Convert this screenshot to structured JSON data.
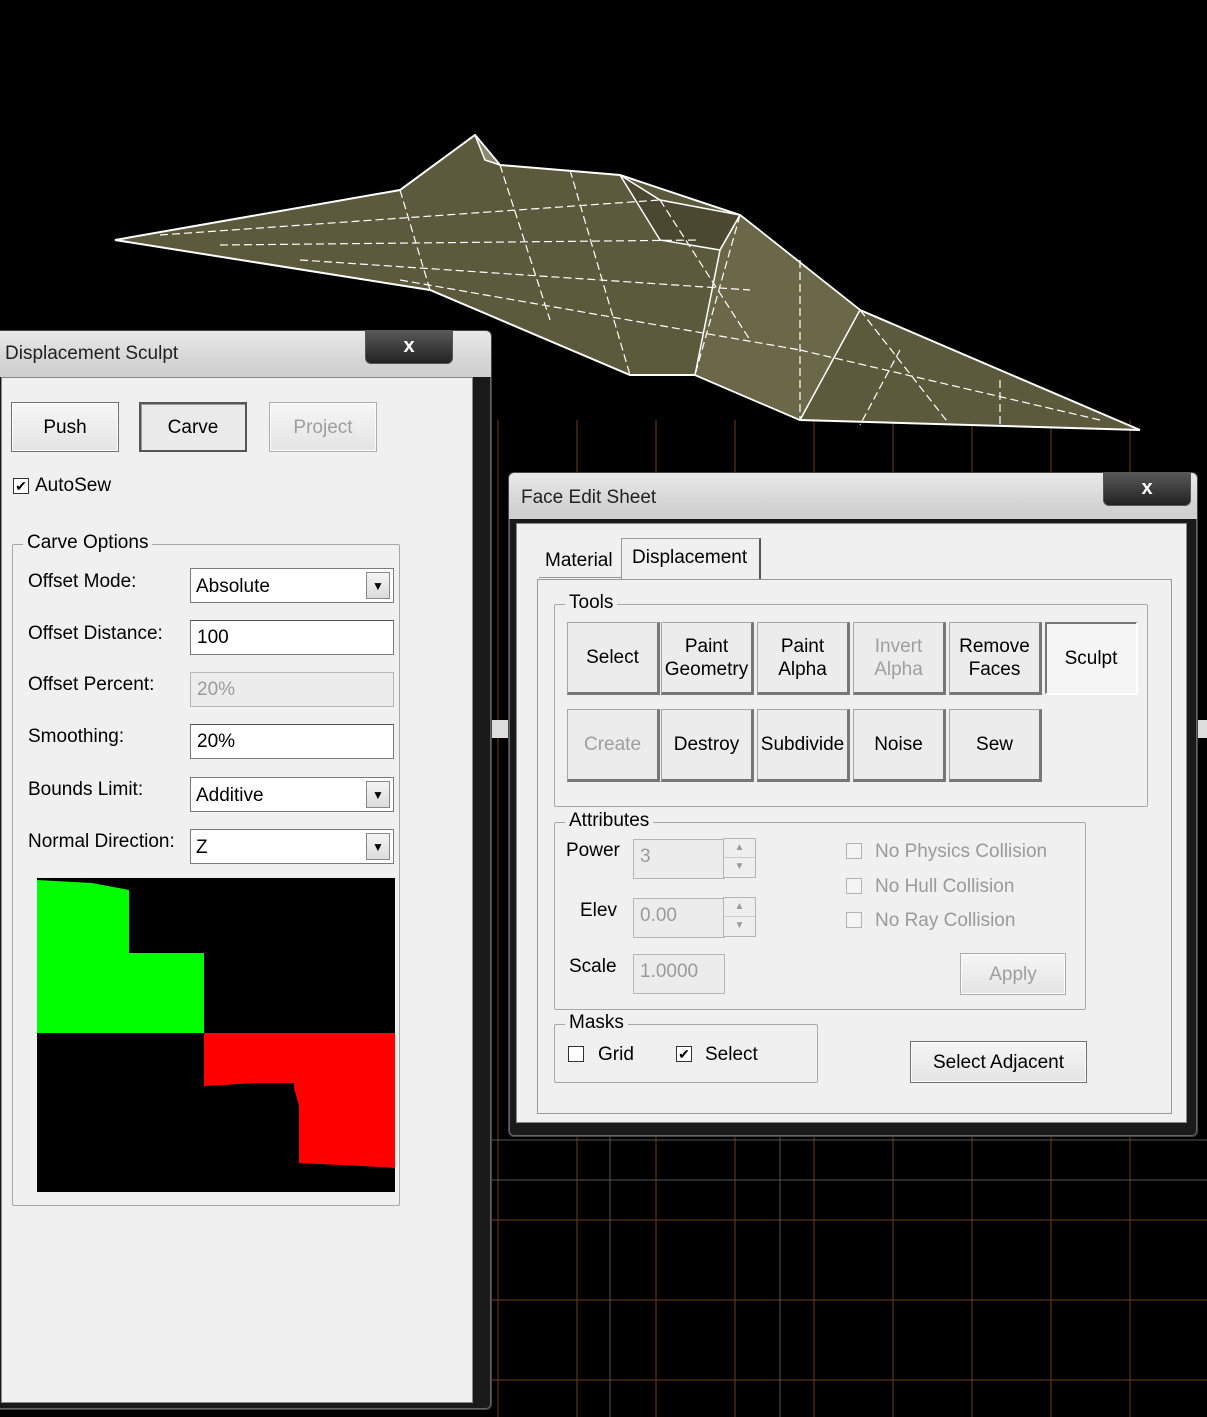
{
  "colors": {
    "green": "#00ff00",
    "red": "#ff0000",
    "terrain": "#5a5a3a",
    "grid": "#7a4a1a"
  },
  "sculpt_window": {
    "title": "Displacement Sculpt",
    "close_label": "x",
    "mode_buttons": {
      "push": "Push",
      "carve": "Carve",
      "project": "Project"
    },
    "autosew": {
      "label": "AutoSew",
      "checked": true
    },
    "carve_options": {
      "group_label": "Carve Options",
      "offset_mode_label": "Offset Mode:",
      "offset_mode_value": "Absolute",
      "offset_distance_label": "Offset Distance:",
      "offset_distance_value": "100",
      "offset_percent_label": "Offset Percent:",
      "offset_percent_value": "20%",
      "smoothing_label": "Smoothing:",
      "smoothing_value": "20%",
      "bounds_limit_label": "Bounds Limit:",
      "bounds_limit_value": "Additive",
      "normal_direction_label": "Normal Direction:",
      "normal_direction_value": "Z"
    }
  },
  "face_edit_window": {
    "title": "Face Edit Sheet",
    "close_label": "x",
    "tabs": {
      "material": "Material",
      "displacement": "Displacement"
    },
    "tools": {
      "group_label": "Tools",
      "select": "Select",
      "paint_geometry_1": "Paint",
      "paint_geometry_2": "Geometry",
      "paint_alpha_1": "Paint",
      "paint_alpha_2": "Alpha",
      "invert_alpha_1": "Invert",
      "invert_alpha_2": "Alpha",
      "remove_faces_1": "Remove",
      "remove_faces_2": "Faces",
      "sculpt": "Sculpt",
      "create": "Create",
      "destroy": "Destroy",
      "subdivide": "Subdivide",
      "noise": "Noise",
      "sew": "Sew"
    },
    "attributes": {
      "group_label": "Attributes",
      "power_label": "Power",
      "power_value": "3",
      "elev_label": "Elev",
      "elev_value": "0.00",
      "scale_label": "Scale",
      "scale_value": "1.0000",
      "no_physics": "No Physics Collision",
      "no_hull": "No Hull Collision",
      "no_ray": "No Ray Collision",
      "apply": "Apply"
    },
    "masks": {
      "group_label": "Masks",
      "grid": "Grid",
      "grid_checked": false,
      "select": "Select",
      "select_checked": true
    },
    "select_adjacent": "Select Adjacent"
  }
}
